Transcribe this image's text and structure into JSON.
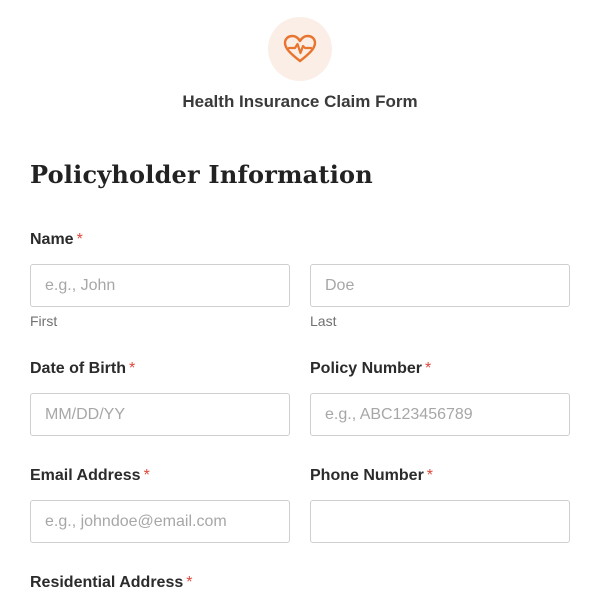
{
  "form": {
    "title": "Health Insurance Claim Form"
  },
  "colors": {
    "accent": "#e8742f",
    "logo_bg": "#fbeee6",
    "required": "#e0473a"
  },
  "logo": {
    "icon": "heartbeat-icon"
  },
  "section": {
    "title": "Policyholder Information"
  },
  "fields": {
    "name": {
      "label": "Name",
      "required_mark": "*",
      "first": {
        "placeholder": "e.g., John",
        "sublabel": "First"
      },
      "last": {
        "placeholder": "Doe",
        "sublabel": "Last"
      }
    },
    "dob": {
      "label": "Date of Birth",
      "required_mark": "*",
      "placeholder": "MM/DD/YY"
    },
    "policy": {
      "label": "Policy Number",
      "required_mark": "*",
      "placeholder": "e.g., ABC123456789"
    },
    "email": {
      "label": "Email Address",
      "required_mark": "*",
      "placeholder": "e.g., johndoe@email.com"
    },
    "phone": {
      "label": "Phone Number",
      "required_mark": "*",
      "placeholder": ""
    },
    "address": {
      "label": "Residential Address",
      "required_mark": "*"
    }
  }
}
